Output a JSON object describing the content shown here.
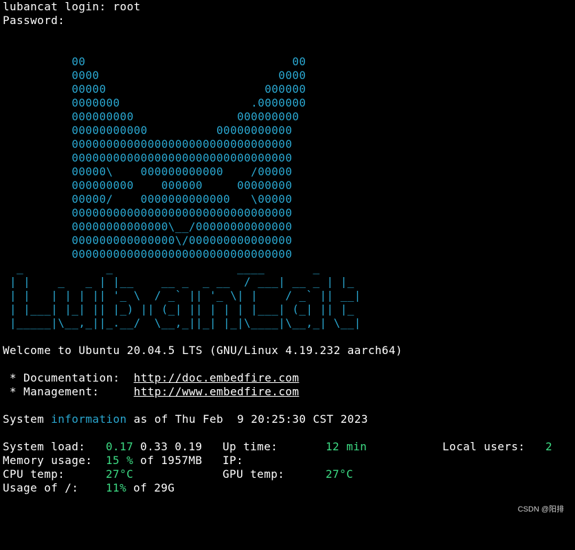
{
  "terminal": {
    "login_line": "lubancat login: root",
    "password_line": "Password:",
    "logo_lines": [
      "          00                              00",
      "          0000                          0000",
      "          00000                       000000",
      "          0000000                   .0000000",
      "          000000000               000000000",
      "          00000000000          00000000000",
      "          00000000000000000000000000000000",
      "          00000000000000000000000000000000",
      "          00000\\    000000000000    /00000",
      "          000000000    000000     00000000",
      "          00000/    0000000000000   \\00000",
      "          00000000000000000000000000000000",
      "          00000000000000\\__/00000000000000",
      "          000000000000000\\/000000000000000",
      "          00000000000000000000000000000000"
    ],
    "banner_lines": [
      "  _            _                  ____       _",
      " | |    _   _ | |__    __ _  _ __  / ___| __ _ | |_",
      " | |   | | | || '_ \\  / _` || '_ \\| |    / _` || __|",
      " | |___| |_| || |_) || (_| || | | | |___| (_| || |_",
      " |_____|\\__,_||_.__/  \\__,_||_| |_|\\____|\\__,_| \\__|"
    ],
    "welcome": "Welcome to Ubuntu 20.04.5 LTS (GNU/Linux 4.19.232 aarch64)",
    "doc_label": " * Documentation:  ",
    "doc_url": "http://doc.embedfire.com",
    "mgmt_label": " * Management:     ",
    "mgmt_url": "http://www.embedfire.com",
    "sysinfo_prefix": "System ",
    "sysinfo_word": "information",
    "sysinfo_suffix": " as of Thu Feb  9 20:25:30 CST 2023",
    "stats": {
      "load_label": "System load:",
      "load_1": "0.17",
      "load_rest": " 0.33 0.19",
      "uptime_label": "Up time:",
      "uptime_value": "12 min",
      "users_label": "Local users:",
      "users_value": "2",
      "mem_label": "Memory usage:",
      "mem_value": "15 %",
      "mem_rest": " of 1957MB",
      "ip_label": "IP:",
      "cpu_label": "CPU temp:",
      "cpu_value": "27°C",
      "gpu_label": "GPU temp:",
      "gpu_value": "27°C",
      "disk_label": "Usage of /:",
      "disk_value": "11%",
      "disk_rest": " of 29G"
    }
  },
  "watermark": "CSDN @阳排",
  "colors": {
    "background": "#000000",
    "text": "#ffffff",
    "cyan": "#2aa7d0",
    "green": "#3ddc84"
  }
}
